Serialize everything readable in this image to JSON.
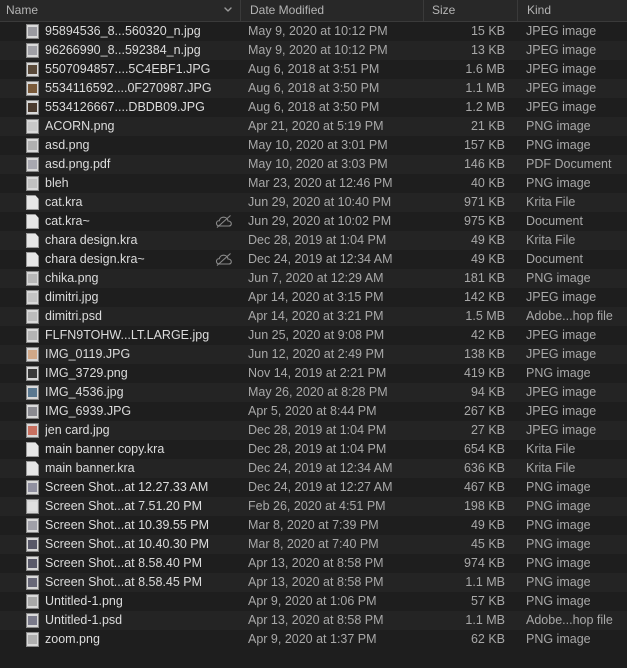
{
  "header": {
    "name": "Name",
    "date_modified": "Date Modified",
    "size": "Size",
    "kind": "Kind"
  },
  "files": [
    {
      "name": "95894536_8...560320_n.jpg",
      "date": "May 9, 2020 at 10:12 PM",
      "size": "15 KB",
      "kind": "JPEG image",
      "icon": "file-thumbnail-icon",
      "thumb": "#9a9aa0",
      "cloud": false
    },
    {
      "name": "96266990_8...592384_n.jpg",
      "date": "May 9, 2020 at 10:12 PM",
      "size": "13 KB",
      "kind": "JPEG image",
      "icon": "file-thumbnail-icon",
      "thumb": "#a0a0a6",
      "cloud": false
    },
    {
      "name": "5507094857....5C4EBF1.JPG",
      "date": "Aug 6, 2018 at 3:51 PM",
      "size": "1.6 MB",
      "kind": "JPEG image",
      "icon": "file-thumbnail-icon",
      "thumb": "#5a4a3a",
      "cloud": false
    },
    {
      "name": "5534116592....0F270987.JPG",
      "date": "Aug 6, 2018 at 3:50 PM",
      "size": "1.1 MB",
      "kind": "JPEG image",
      "icon": "file-thumbnail-icon",
      "thumb": "#7a5a3a",
      "cloud": false
    },
    {
      "name": "5534126667....DBDB09.JPG",
      "date": "Aug 6, 2018 at 3:50 PM",
      "size": "1.2 MB",
      "kind": "JPEG image",
      "icon": "file-thumbnail-icon",
      "thumb": "#4a3a2e",
      "cloud": false
    },
    {
      "name": "ACORN.png",
      "date": "Apr 21, 2020 at 5:19 PM",
      "size": "21 KB",
      "kind": "PNG image",
      "icon": "file-thumbnail-icon",
      "thumb": "#c8c8c8",
      "cloud": false
    },
    {
      "name": "asd.png",
      "date": "May 10, 2020 at 3:01 PM",
      "size": "157 KB",
      "kind": "PNG image",
      "icon": "file-thumbnail-icon",
      "thumb": "#b0b0b0",
      "cloud": false
    },
    {
      "name": "asd.png.pdf",
      "date": "May 10, 2020 at 3:03 PM",
      "size": "146 KB",
      "kind": "PDF Document",
      "icon": "file-thumbnail-icon",
      "thumb": "#a8a8b0",
      "cloud": false
    },
    {
      "name": "bleh",
      "date": "Mar 23, 2020 at 12:46 PM",
      "size": "40 KB",
      "kind": "PNG image",
      "icon": "file-thumbnail-icon",
      "thumb": "#c0c0c0",
      "cloud": false
    },
    {
      "name": "cat.kra",
      "date": "Jun 29, 2020 at 10:40 PM",
      "size": "971 KB",
      "kind": "Krita File",
      "icon": "document-icon",
      "cloud": false
    },
    {
      "name": "cat.kra~",
      "date": "Jun 29, 2020 at 10:02 PM",
      "size": "975 KB",
      "kind": "Document",
      "icon": "document-icon",
      "cloud": true
    },
    {
      "name": "chara design.kra",
      "date": "Dec 28, 2019 at 1:04 PM",
      "size": "49 KB",
      "kind": "Krita File",
      "icon": "document-icon",
      "cloud": false
    },
    {
      "name": "chara design.kra~",
      "date": "Dec 24, 2019 at 12:34 AM",
      "size": "49 KB",
      "kind": "Document",
      "icon": "document-icon",
      "cloud": true
    },
    {
      "name": "chika.png",
      "date": "Jun 7, 2020 at 12:29 AM",
      "size": "181 KB",
      "kind": "PNG image",
      "icon": "file-thumbnail-icon",
      "thumb": "#b8b8b8",
      "cloud": false
    },
    {
      "name": "dimitri.jpg",
      "date": "Apr 14, 2020 at 3:15 PM",
      "size": "142 KB",
      "kind": "JPEG image",
      "icon": "file-thumbnail-icon",
      "thumb": "#c4c4c4",
      "cloud": false
    },
    {
      "name": "dimitri.psd",
      "date": "Apr 14, 2020 at 3:21 PM",
      "size": "1.5 MB",
      "kind": "Adobe...hop file",
      "icon": "file-thumbnail-icon",
      "thumb": "#bcbcbc",
      "cloud": false
    },
    {
      "name": "FLFN9TOHW...LT.LARGE.jpg",
      "date": "Jun 25, 2020 at 9:08 PM",
      "size": "42 KB",
      "kind": "JPEG image",
      "icon": "file-thumbnail-icon",
      "thumb": "#b4b4b4",
      "cloud": false
    },
    {
      "name": "IMG_0119.JPG",
      "date": "Jun 12, 2020 at 2:49 PM",
      "size": "138 KB",
      "kind": "JPEG image",
      "icon": "file-thumbnail-icon",
      "thumb": "#d0a888",
      "cloud": false
    },
    {
      "name": "IMG_3729.png",
      "date": "Nov 14, 2019 at 2:21 PM",
      "size": "419 KB",
      "kind": "PNG image",
      "icon": "file-thumbnail-icon",
      "thumb": "#3a3a3a",
      "cloud": false
    },
    {
      "name": "IMG_4536.jpg",
      "date": "May 26, 2020 at 8:28 PM",
      "size": "94 KB",
      "kind": "JPEG image",
      "icon": "file-thumbnail-icon",
      "thumb": "#5a7890",
      "cloud": false
    },
    {
      "name": "IMG_6939.JPG",
      "date": "Apr 5, 2020 at 8:44 PM",
      "size": "267 KB",
      "kind": "JPEG image",
      "icon": "file-thumbnail-icon",
      "thumb": "#8a8a90",
      "cloud": false
    },
    {
      "name": "jen card.jpg",
      "date": "Dec 28, 2019 at 1:04 PM",
      "size": "27 KB",
      "kind": "JPEG image",
      "icon": "file-thumbnail-icon",
      "thumb": "#c87060",
      "cloud": false
    },
    {
      "name": "main banner copy.kra",
      "date": "Dec 28, 2019 at 1:04 PM",
      "size": "654 KB",
      "kind": "Krita File",
      "icon": "document-icon",
      "cloud": false
    },
    {
      "name": "main banner.kra",
      "date": "Dec 24, 2019 at 12:34 AM",
      "size": "636 KB",
      "kind": "Krita File",
      "icon": "document-icon",
      "cloud": false
    },
    {
      "name": "Screen Shot...at 12.27.33 AM",
      "date": "Dec 24, 2019 at 12:27 AM",
      "size": "467 KB",
      "kind": "PNG image",
      "icon": "file-thumbnail-icon",
      "thumb": "#9090a0",
      "cloud": false
    },
    {
      "name": "Screen Shot...at 7.51.20 PM",
      "date": "Feb 26, 2020 at 4:51 PM",
      "size": "198 KB",
      "kind": "PNG image",
      "icon": "file-thumbnail-icon",
      "thumb": "#e0e0e0",
      "cloud": false
    },
    {
      "name": "Screen Shot...at 10.39.55 PM",
      "date": "Mar 8, 2020 at 7:39 PM",
      "size": "49 KB",
      "kind": "PNG image",
      "icon": "file-thumbnail-icon",
      "thumb": "#a0a0a8",
      "cloud": false
    },
    {
      "name": "Screen Shot...at 10.40.30 PM",
      "date": "Mar 8, 2020 at 7:40 PM",
      "size": "45 KB",
      "kind": "PNG image",
      "icon": "file-thumbnail-icon",
      "thumb": "#585868",
      "cloud": false
    },
    {
      "name": "Screen Shot...at 8.58.40 PM",
      "date": "Apr 13, 2020 at 8:58 PM",
      "size": "974 KB",
      "kind": "PNG image",
      "icon": "file-thumbnail-icon",
      "thumb": "#5a5a6a",
      "cloud": false
    },
    {
      "name": "Screen Shot...at 8.58.45 PM",
      "date": "Apr 13, 2020 at 8:58 PM",
      "size": "1.1 MB",
      "kind": "PNG image",
      "icon": "file-thumbnail-icon",
      "thumb": "#686878",
      "cloud": false
    },
    {
      "name": "Untitled-1.png",
      "date": "Apr 9, 2020 at 1:06 PM",
      "size": "57 KB",
      "kind": "PNG image",
      "icon": "file-thumbnail-icon",
      "thumb": "#a8a8a8",
      "cloud": false
    },
    {
      "name": "Untitled-1.psd",
      "date": "Apr 13, 2020 at 8:58 PM",
      "size": "1.1 MB",
      "kind": "Adobe...hop file",
      "icon": "file-thumbnail-icon",
      "thumb": "#7a7a8a",
      "cloud": false
    },
    {
      "name": "zoom.png",
      "date": "Apr 9, 2020 at 1:37 PM",
      "size": "62 KB",
      "kind": "PNG image",
      "icon": "file-thumbnail-icon",
      "thumb": "#b0b0b0",
      "cloud": false
    }
  ]
}
